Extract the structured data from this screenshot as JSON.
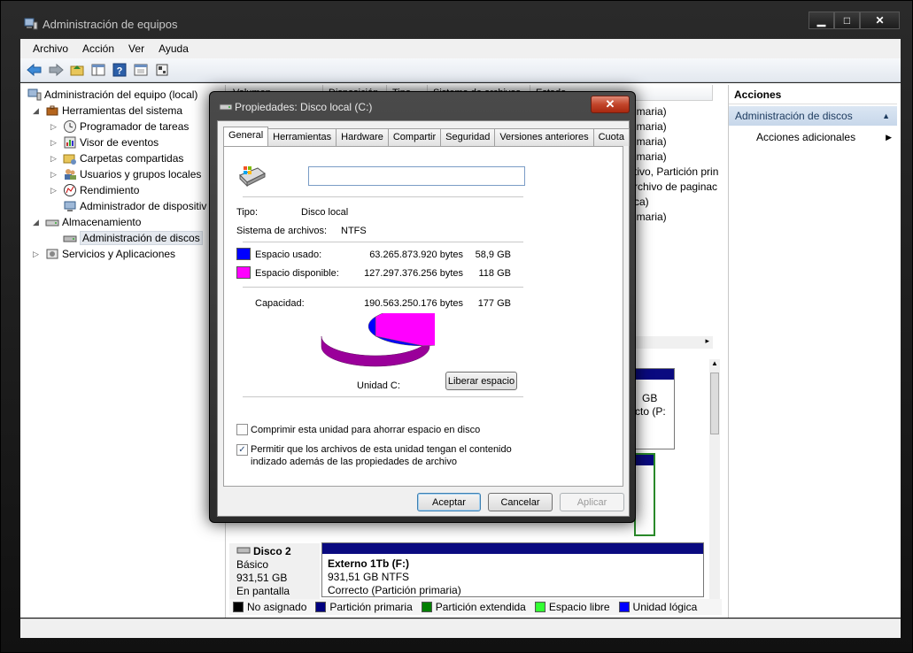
{
  "window": {
    "title": "Administración de equipos",
    "controls": {
      "minimize": "▁",
      "maximize": "□",
      "close": "✕"
    }
  },
  "menu": [
    "Archivo",
    "Acción",
    "Ver",
    "Ayuda"
  ],
  "toolbar_icons": [
    "back-arrow-icon",
    "forward-arrow-icon",
    "folder-up-icon",
    "show-hide-tree-icon",
    "help-icon",
    "properties-icon",
    "export-icon"
  ],
  "tree": {
    "root": "Administración del equipo (local)",
    "tools": "Herramientas del sistema",
    "task_scheduler": "Programador de tareas",
    "event_viewer": "Visor de eventos",
    "shared_folders": "Carpetas compartidas",
    "users_groups": "Usuarios y grupos locales",
    "performance": "Rendimiento",
    "device_manager": "Administrador de dispositiv",
    "storage": "Almacenamiento",
    "disk_management": "Administración de discos",
    "services": "Servicios y Aplicaciones"
  },
  "volume_list": {
    "headers": [
      "Volumen",
      "Disposición",
      "Tipo",
      "Sistema de archivos",
      "Estado"
    ],
    "visible_rows": [
      "imaria)",
      "imaria)",
      "imaria)",
      "imaria)",
      "tivo, Partición prin",
      "rchivo de paginac",
      "ca)",
      "imaria)"
    ]
  },
  "disk_panel": {
    "partial1": [
      "GB",
      "cto (P:"
    ],
    "disk2_title": "Disco 2",
    "disk2_type": "Básico",
    "disk2_size": "931,51 GB",
    "disk2_status": "En pantalla",
    "ext_name": "Externo 1Tb  (F:)",
    "ext_size": "931,51 GB NTFS",
    "ext_status": "Correcto (Partición primaria)"
  },
  "legend": [
    {
      "label": "No asignado",
      "color": "#000000"
    },
    {
      "label": "Partición primaria",
      "color": "#00007f"
    },
    {
      "label": "Partición extendida",
      "color": "#007f00"
    },
    {
      "label": "Espacio libre",
      "color": "#33ff33"
    },
    {
      "label": "Unidad lógica",
      "color": "#0000ff"
    }
  ],
  "actions": {
    "title": "Acciones",
    "section": "Administración de discos",
    "more": "Acciones adicionales"
  },
  "dialog": {
    "title": "Propiedades: Disco local (C:)",
    "close_glyph": "✕",
    "tabs": [
      "General",
      "Herramientas",
      "Hardware",
      "Compartir",
      "Seguridad",
      "Versiones anteriores",
      "Cuota"
    ],
    "active_tab": "General",
    "volume_name_value": "",
    "type_label": "Tipo:",
    "type_value": "Disco local",
    "fs_label": "Sistema de archivos:",
    "fs_value": "NTFS",
    "used_label": "Espacio usado:",
    "used_bytes": "63.265.873.920 bytes",
    "used_gb": "58,9 GB",
    "free_label": "Espacio disponible:",
    "free_bytes": "127.297.376.256 bytes",
    "free_gb": "118 GB",
    "capacity_label": "Capacidad:",
    "capacity_bytes": "190.563.250.176 bytes",
    "capacity_gb": "177 GB",
    "used_color": "#0000ff",
    "free_color": "#ff00ff",
    "used_fraction": 0.332,
    "drive_label": "Unidad C:",
    "cleanup_button": "Liberar espacio",
    "compress_label": "Comprimir esta unidad para ahorrar espacio en disco",
    "compress_checked": false,
    "index_label_line1": "Permitir que los archivos de esta unidad tengan el contenido",
    "index_label_line2": "indizado además de las propiedades de archivo",
    "index_checked": true,
    "ok": "Aceptar",
    "cancel": "Cancelar",
    "apply": "Aplicar"
  }
}
